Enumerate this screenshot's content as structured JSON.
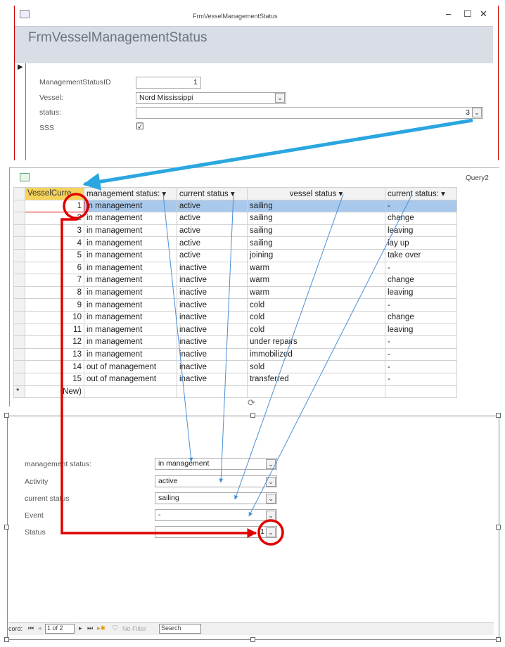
{
  "form": {
    "window_title": "FrmVesselManagementStatus",
    "header_title": "FrmVesselManagementStatus",
    "controls": {
      "minimize": "–",
      "maximize": "☐",
      "close": "✕"
    },
    "fields": [
      {
        "label": "ManagementStatusID",
        "value": "1"
      },
      {
        "label": "Vessel:",
        "value": "Nord Mississippi"
      },
      {
        "label": "status:",
        "value": "3"
      },
      {
        "label": "SSS",
        "value": "☑"
      }
    ]
  },
  "query": {
    "title": "Query2",
    "columns": [
      "VesselCurre",
      "management status:",
      "current status",
      "vessel status",
      "current status:"
    ],
    "rows": [
      [
        "1",
        "in management",
        "active",
        "sailing",
        "-"
      ],
      [
        "2",
        "in management",
        "active",
        "sailing",
        "change"
      ],
      [
        "3",
        "in management",
        "active",
        "sailing",
        "leaving"
      ],
      [
        "4",
        "in management",
        "active",
        "sailing",
        "lay up"
      ],
      [
        "5",
        "in management",
        "active",
        "joining",
        "take over"
      ],
      [
        "6",
        "in management",
        "inactive",
        "warm",
        "-"
      ],
      [
        "7",
        "in management",
        "inactive",
        "warm",
        "change"
      ],
      [
        "8",
        "in management",
        "inactive",
        "warm",
        "leaving"
      ],
      [
        "9",
        "in management",
        "inactive",
        "cold",
        "-"
      ],
      [
        "10",
        "in management",
        "inactive",
        "cold",
        "change"
      ],
      [
        "11",
        "in management",
        "inactive",
        "cold",
        "leaving"
      ],
      [
        "12",
        "in management",
        "inactive",
        "under repairs",
        "-"
      ],
      [
        "13",
        "in management",
        "inactive",
        "immobilized",
        "-"
      ],
      [
        "14",
        "out of management",
        "inactive",
        "sold",
        "-"
      ],
      [
        "15",
        "out of management",
        "inactive",
        "transferred",
        "-"
      ]
    ],
    "new_row_marker": "*",
    "new_row_label": "(New)"
  },
  "subform": {
    "fields": [
      {
        "label": "management status:",
        "value": "in management"
      },
      {
        "label": "Activity",
        "value": "active"
      },
      {
        "label": "current status",
        "value": "sailing"
      },
      {
        "label": "Event",
        "value": "-"
      },
      {
        "label": "Status",
        "value": "1"
      }
    ],
    "nav": {
      "record_label": "cord:",
      "position": "1 of 2",
      "filter": "No Filter",
      "search": "Search"
    }
  },
  "colors": {
    "highlight_red": "#e00000",
    "arrow_blue": "#2aa6e0",
    "row_select": "#a8c8ec"
  }
}
